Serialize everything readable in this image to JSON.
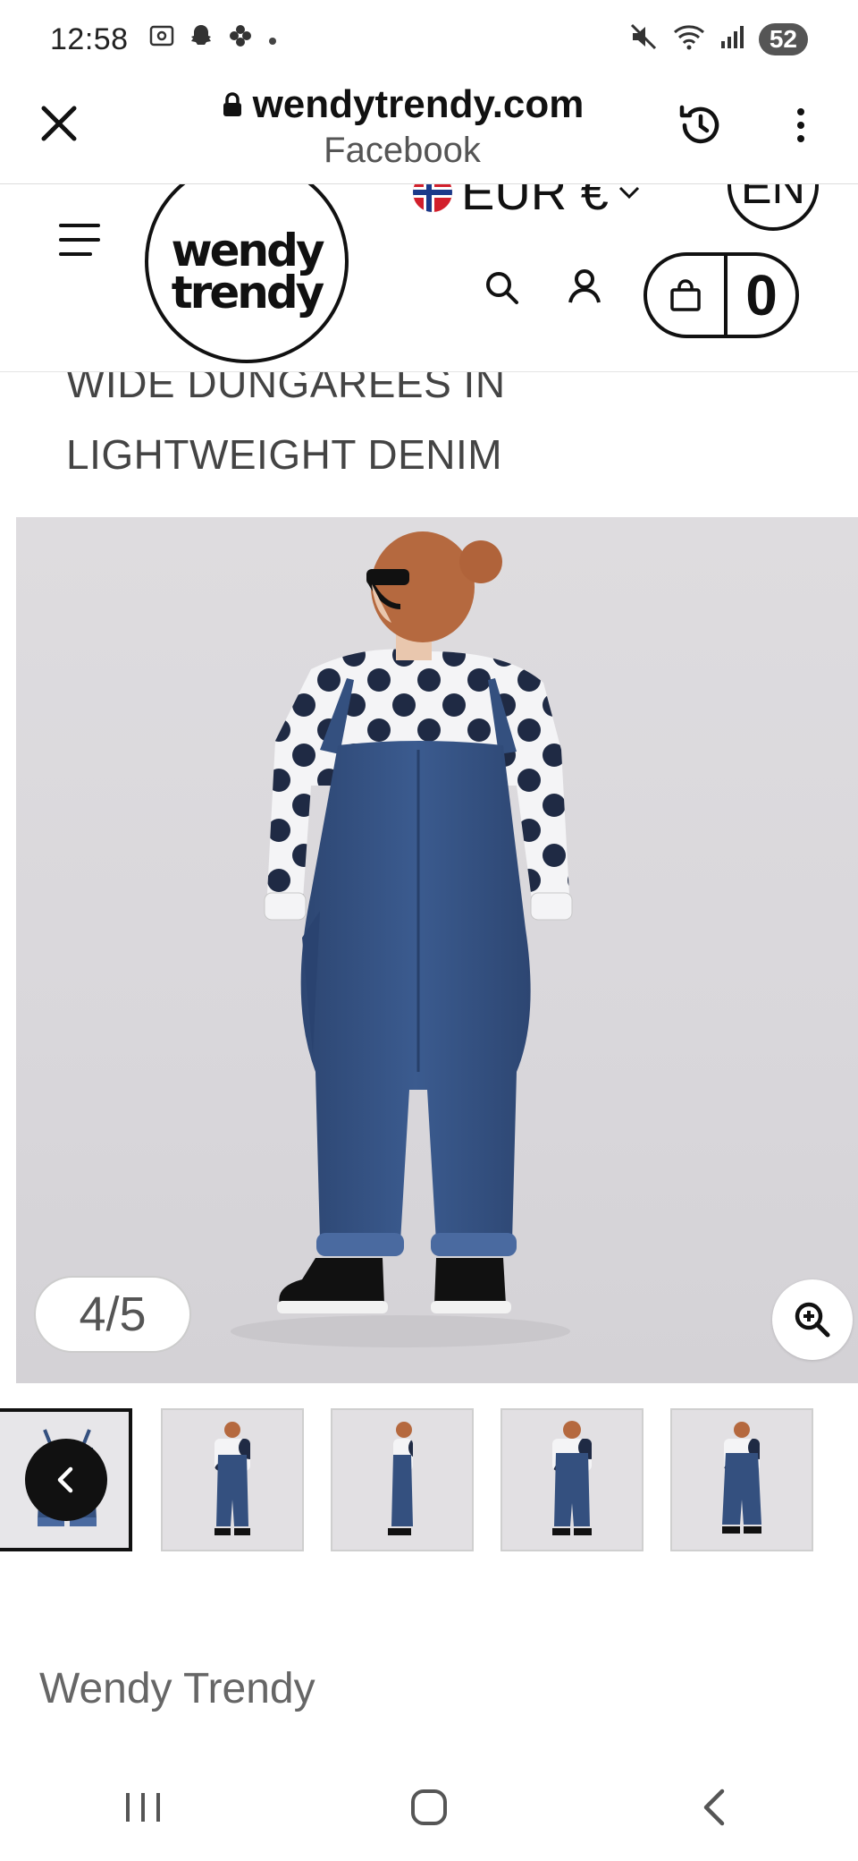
{
  "status_bar": {
    "time": "12:58",
    "battery": "52",
    "left_icons": [
      "screenshot-icon",
      "snapchat-icon",
      "flower-icon",
      "dot-icon"
    ],
    "right_icons": [
      "mute-icon",
      "wifi-icon",
      "signal-icon"
    ]
  },
  "browser": {
    "url": "wendytrendy.com",
    "referrer": "Facebook"
  },
  "header": {
    "logo_line1": "wendy",
    "logo_line2": "trendy",
    "currency": "EUR €",
    "language": "EN",
    "cart_count": "0"
  },
  "product": {
    "title_line1": "WIDE DUNGAREES IN",
    "title_line2": "LIGHTWEIGHT DENIM",
    "image_counter": "4/5",
    "thumbnail_count": 5,
    "active_thumbnail": 1
  },
  "brand": {
    "name": "Wendy Trendy"
  },
  "colors": {
    "denim": "#34507f",
    "shirt_dot": "#1f2a44",
    "background": "#dcdadd"
  }
}
